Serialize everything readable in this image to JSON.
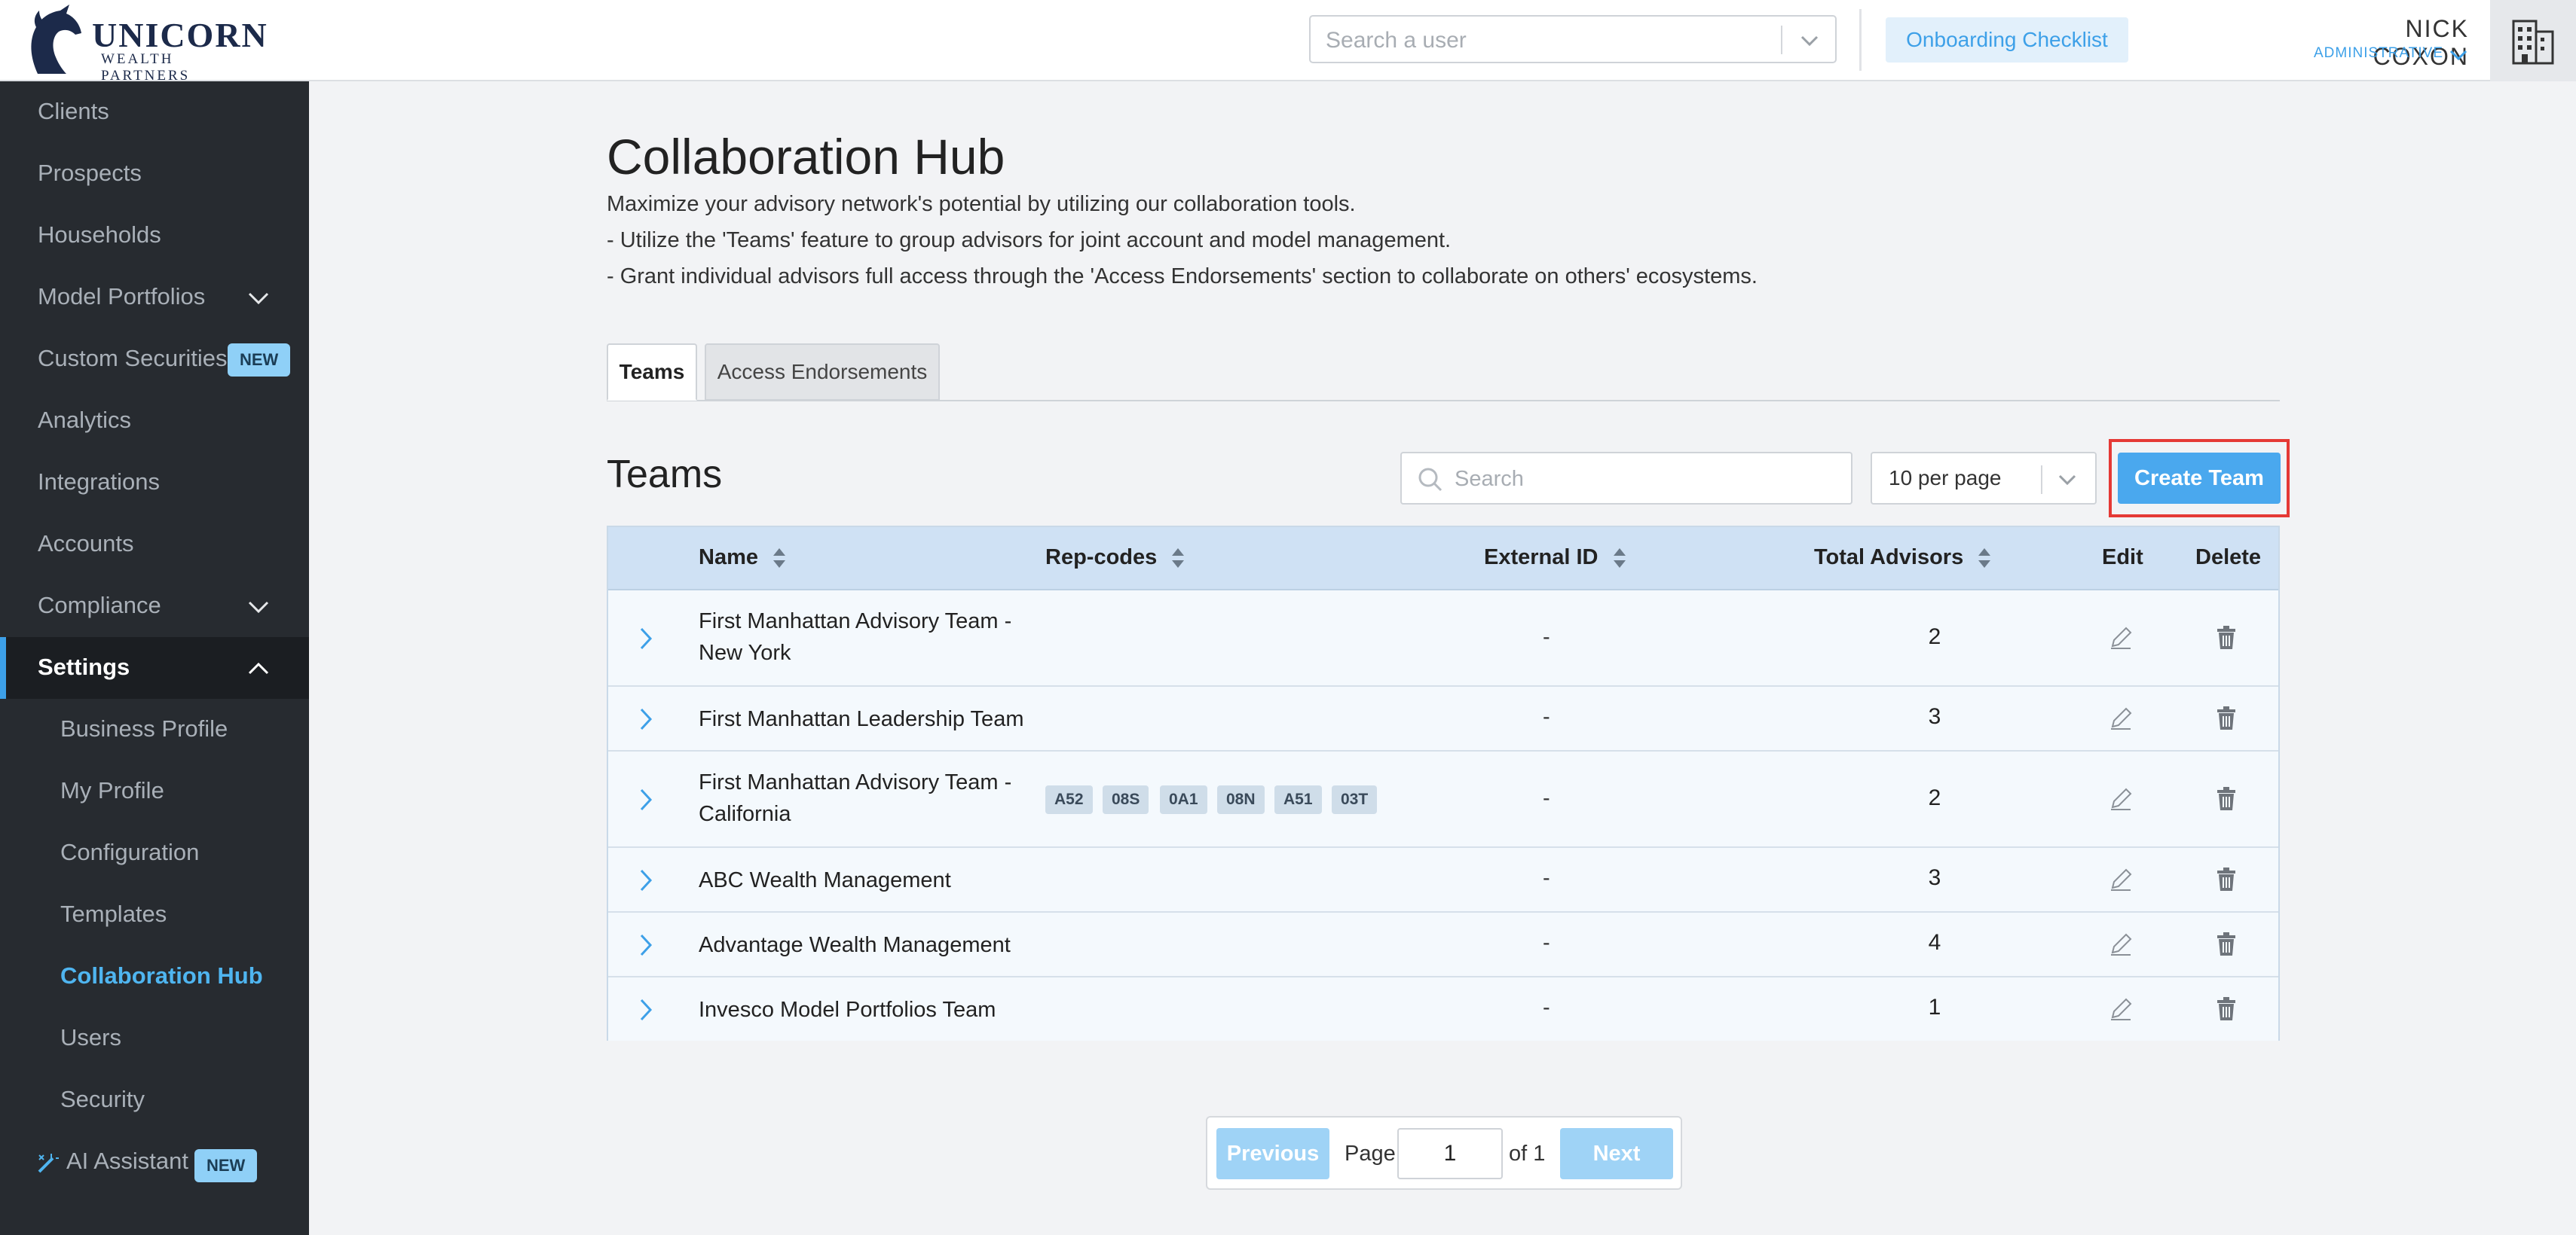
{
  "brand": {
    "name": "UNICORN",
    "tagline": "WEALTH PARTNERS"
  },
  "header": {
    "user_search_placeholder": "Search a user",
    "onboarding_label": "Onboarding Checklist",
    "user_name": "NICK COXON",
    "user_role": "ADMINISTRATIVE"
  },
  "sidebar": {
    "items": [
      {
        "label": "Clients"
      },
      {
        "label": "Prospects"
      },
      {
        "label": "Households"
      },
      {
        "label": "Model Portfolios"
      },
      {
        "label": "Custom Securities",
        "badge": "NEW"
      },
      {
        "label": "Analytics"
      },
      {
        "label": "Integrations"
      },
      {
        "label": "Accounts"
      },
      {
        "label": "Compliance"
      },
      {
        "label": "Settings"
      }
    ],
    "settings_sub": [
      {
        "label": "Business Profile"
      },
      {
        "label": "My Profile"
      },
      {
        "label": "Configuration"
      },
      {
        "label": "Templates"
      },
      {
        "label": "Collaboration Hub"
      },
      {
        "label": "Users"
      },
      {
        "label": "Security"
      }
    ],
    "ai_assistant": {
      "label": "AI Assistant",
      "badge": "NEW"
    }
  },
  "page": {
    "title": "Collaboration Hub",
    "description": [
      "Maximize your advisory network's potential by utilizing our collaboration tools.",
      "- Utilize the 'Teams' feature to group advisors for joint account and model management.",
      "- Grant individual advisors full access through the 'Access Endorsements' section to collaborate on others' ecosystems."
    ],
    "tabs": [
      {
        "label": "Teams"
      },
      {
        "label": "Access Endorsements"
      }
    ]
  },
  "teams": {
    "section_title": "Teams",
    "search_placeholder": "Search",
    "per_page": "10 per page",
    "create_label": "Create Team",
    "columns": {
      "name": "Name",
      "rep_codes": "Rep-codes",
      "external_id": "External ID",
      "total_advisors": "Total Advisors",
      "edit": "Edit",
      "delete": "Delete"
    },
    "rows": [
      {
        "name": "First Manhattan Advisory Team - New York",
        "rep_codes": [],
        "external_id": "-",
        "total_advisors": "2"
      },
      {
        "name": "First Manhattan Leadership Team",
        "rep_codes": [],
        "external_id": "-",
        "total_advisors": "3"
      },
      {
        "name": "First Manhattan Advisory Team - California",
        "rep_codes": [
          "A52",
          "08S",
          "0A1",
          "08N",
          "A51",
          "03T"
        ],
        "external_id": "-",
        "total_advisors": "2"
      },
      {
        "name": "ABC Wealth Management",
        "rep_codes": [],
        "external_id": "-",
        "total_advisors": "3"
      },
      {
        "name": "Advantage Wealth Management",
        "rep_codes": [],
        "external_id": "-",
        "total_advisors": "4"
      },
      {
        "name": "Invesco Model Portfolios Team",
        "rep_codes": [],
        "external_id": "-",
        "total_advisors": "1"
      }
    ]
  },
  "pagination": {
    "previous": "Previous",
    "page_label": "Page",
    "current": "1",
    "of_label": "of 1",
    "next": "Next"
  },
  "colors": {
    "accent": "#3da0e8",
    "sidebar_bg": "#272b30",
    "highlight_border": "#e53935"
  }
}
